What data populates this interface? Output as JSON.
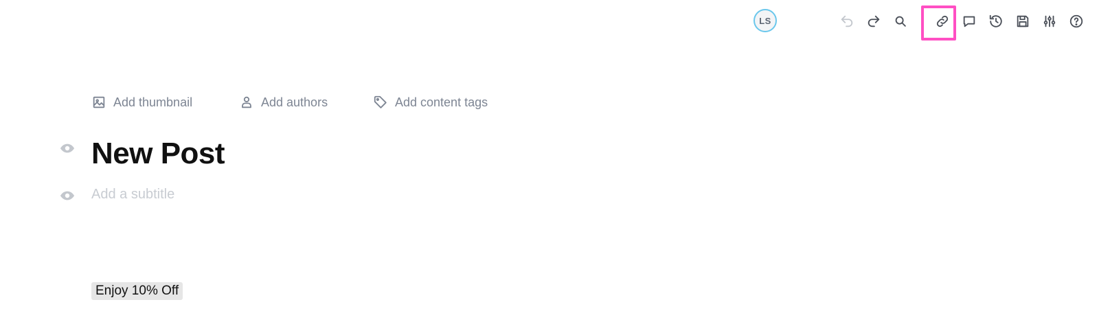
{
  "toolbar": {
    "avatar_initials": "LS",
    "icons": {
      "undo": "undo-icon",
      "redo": "redo-icon",
      "search": "search-icon",
      "link": "link-icon",
      "comment": "comment-icon",
      "history": "history-icon",
      "save": "save-icon",
      "settings": "sliders-icon",
      "help": "help-icon"
    },
    "highlight_color": "#ff4fc3"
  },
  "meta": {
    "thumbnail_label": "Add thumbnail",
    "authors_label": "Add authors",
    "tags_label": "Add content tags"
  },
  "post": {
    "title": "New Post",
    "subtitle_placeholder": "Add a subtitle",
    "promo_text": "Enjoy 10% Off"
  },
  "colors": {
    "icon_gray": "#5b6472",
    "meta_gray": "#7d8593",
    "placeholder_gray": "#c8ccd2",
    "avatar_ring": "#6ac7ec"
  }
}
